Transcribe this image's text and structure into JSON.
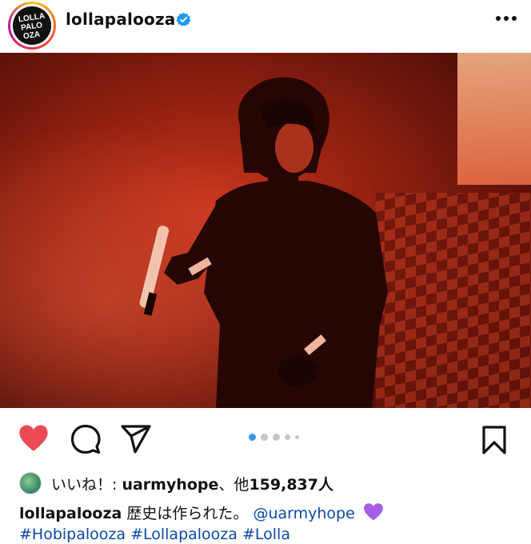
{
  "post": {
    "username": "lollapalooza",
    "avatar_text": [
      "LOLLA",
      "PALO",
      "OZA"
    ],
    "verified": true,
    "image_description_icon": "photo",
    "carousel": {
      "count": 5,
      "active_index": 0
    }
  },
  "actions": {
    "like_icon": "heart-filled-icon",
    "comment_icon": "comment-icon",
    "share_icon": "send-icon",
    "save_icon": "bookmark-icon",
    "like_color": "#ed4956"
  },
  "likes": {
    "prefix": "いいね！: ",
    "user": "uarmyhope",
    "suffix": "、他",
    "count": "159,837",
    "unit": "人"
  },
  "caption": {
    "username": "lollapalooza",
    "text": "歴史は作られた。",
    "mention": "@uarmyhope",
    "emoji": "purple-heart",
    "hashtags": [
      "#Hobipalooza",
      "#Lollapalooza",
      "#Lolla"
    ]
  }
}
